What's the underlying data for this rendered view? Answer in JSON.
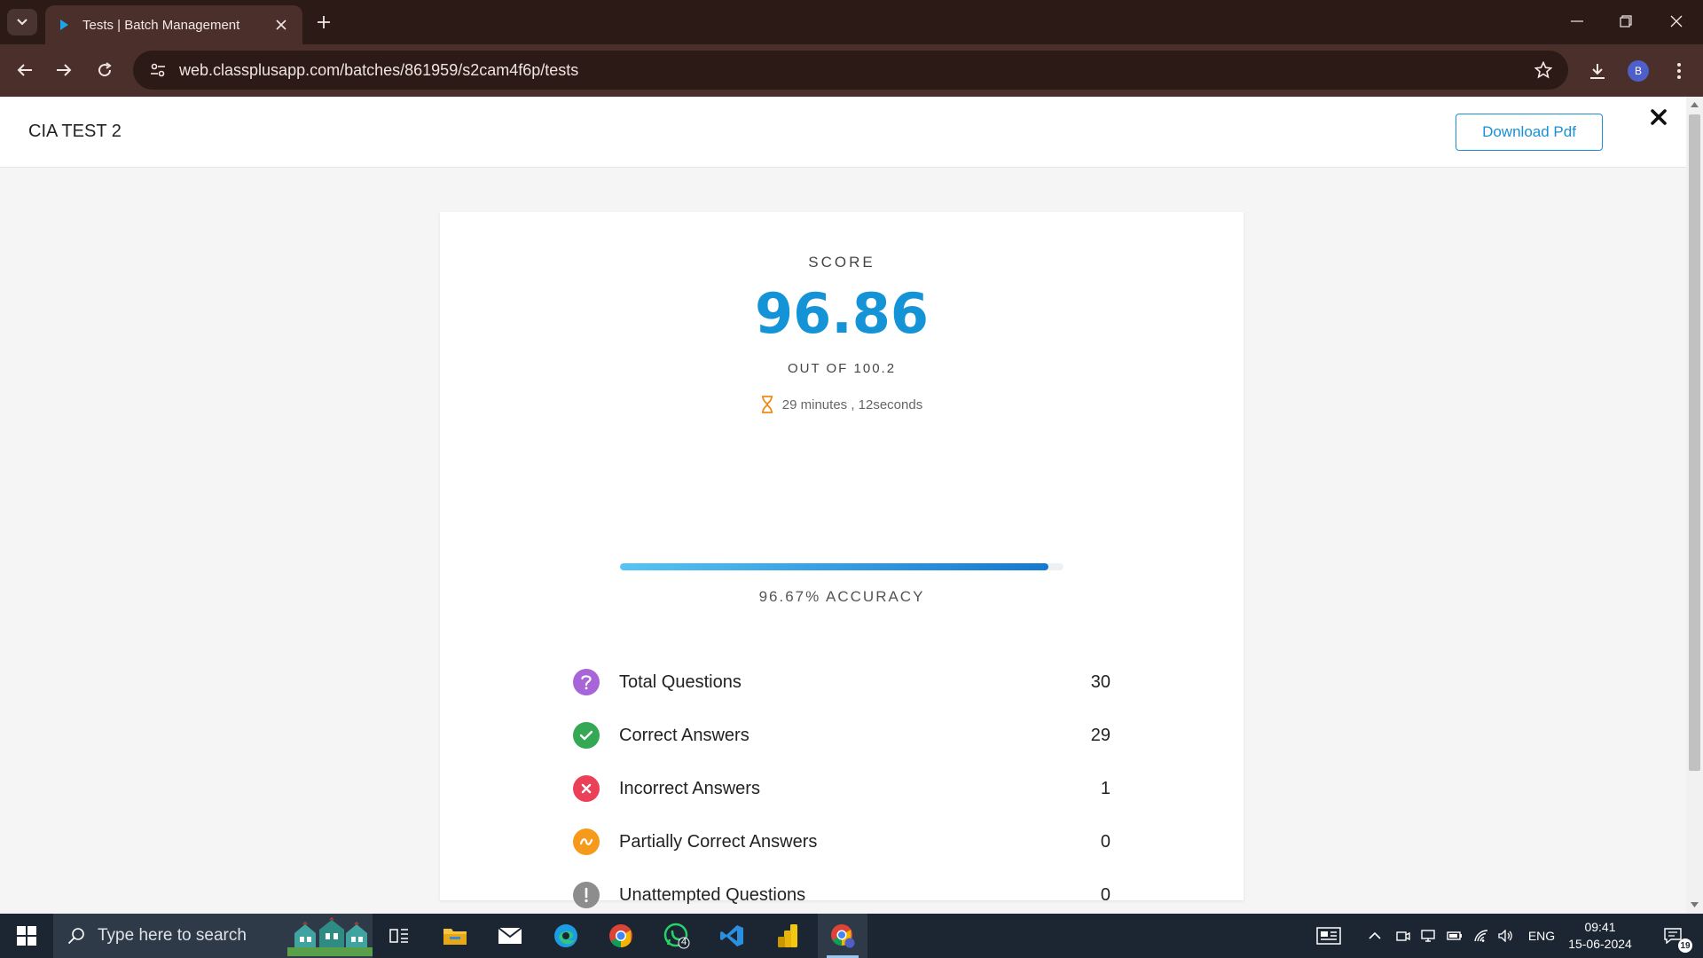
{
  "browser": {
    "tab_title": "Tests | Batch Management",
    "url": "web.classplusapp.com/batches/861959/s2cam4f6p/tests",
    "profile_initial": "B"
  },
  "header": {
    "title": "CIA TEST 2",
    "download_label": "Download Pdf"
  },
  "score": {
    "label": "SCORE",
    "value": "96.86",
    "out_of": "OUT OF 100.2",
    "time_taken": "29 minutes , 12seconds",
    "accuracy_percent": 96.67,
    "accuracy_label": "96.67% ACCURACY"
  },
  "stats": [
    {
      "label": "Total Questions",
      "value": "30",
      "color": "#a865d8",
      "icon": "question-icon"
    },
    {
      "label": "Correct Answers",
      "value": "29",
      "color": "#34a853",
      "icon": "check-icon"
    },
    {
      "label": "Incorrect Answers",
      "value": "1",
      "color": "#ea4058",
      "icon": "cross-icon"
    },
    {
      "label": "Partially Correct Answers",
      "value": "0",
      "color": "#f59a1b",
      "icon": "tilde-icon"
    },
    {
      "label": "Unattempted Questions",
      "value": "0",
      "color": "#8d8d8d",
      "icon": "exclamation-icon"
    }
  ],
  "taskbar": {
    "search_placeholder": "Type here to search",
    "language": "ENG",
    "time": "09:41",
    "date": "15-06-2024",
    "notification_count": "19",
    "whatsapp_badge": "4"
  },
  "colors": {
    "accent": "#1494d6",
    "timer_icon": "#f28a1b"
  }
}
